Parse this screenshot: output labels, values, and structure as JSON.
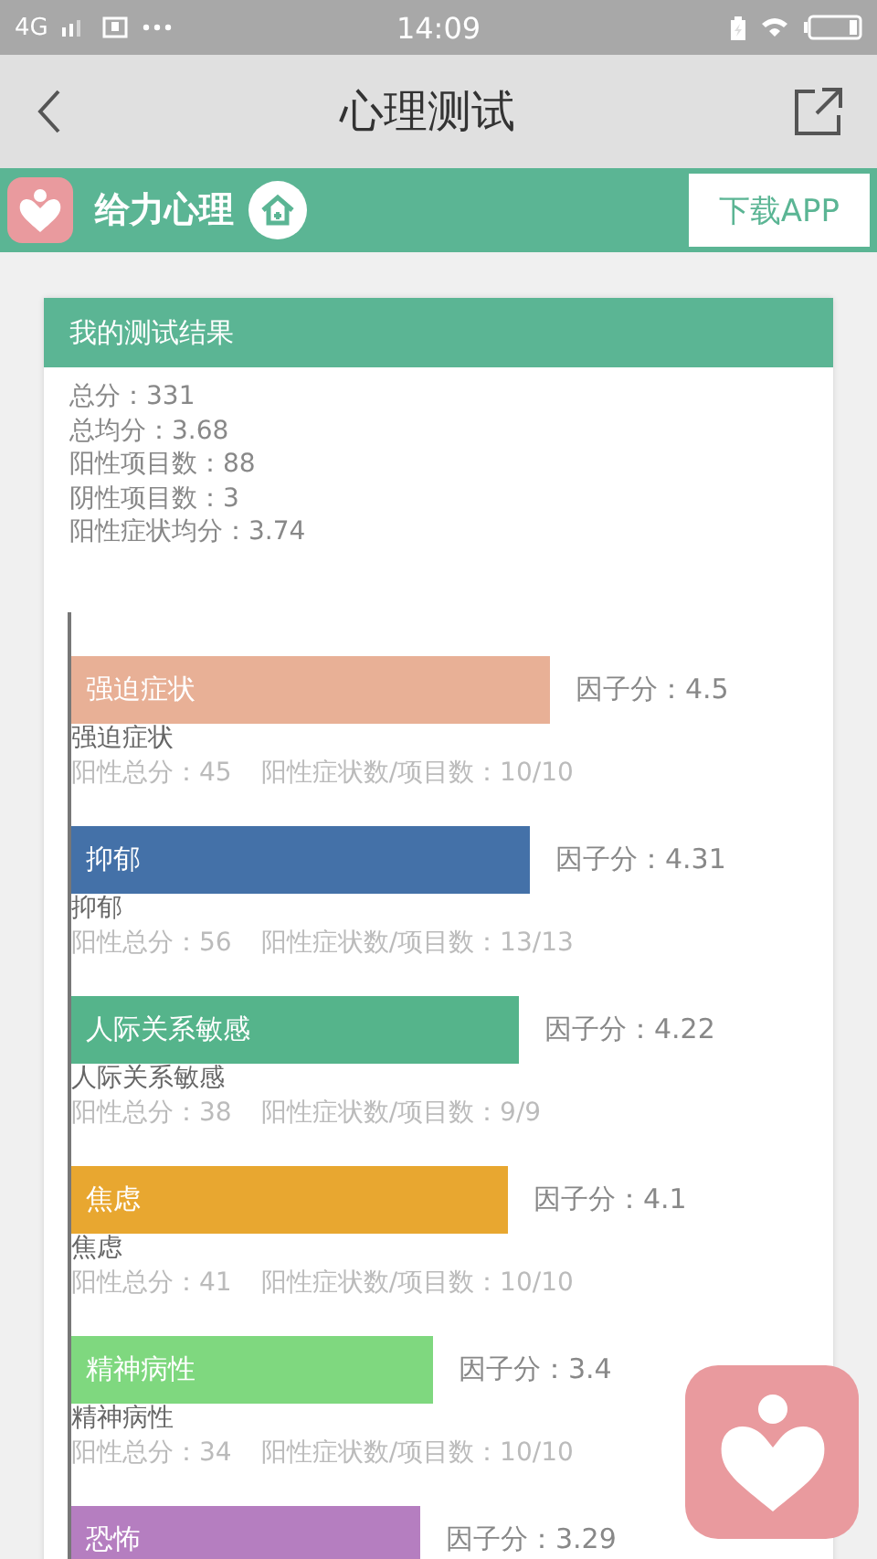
{
  "status_bar": {
    "network": "4G",
    "time": "14:09"
  },
  "nav": {
    "title": "心理测试"
  },
  "banner": {
    "brand": "给力心理",
    "download": "下载APP"
  },
  "card": {
    "title": "我的测试结果",
    "stats": [
      "总分：331",
      "总均分：3.68",
      "阳性项目数：88",
      "阴性项目数：3",
      "阳性症状均分：3.74"
    ],
    "factors": [
      {
        "name": "强迫症状",
        "score": "因子分：4.5",
        "color": "#e8b096",
        "caption": "强迫症状",
        "total": "阳性总分：45",
        "ratio": "阳性症状数/项目数：10/10"
      },
      {
        "name": "抑郁",
        "score": "因子分：4.31",
        "color": "#4471a8",
        "caption": "抑郁",
        "total": "阳性总分：56",
        "ratio": "阳性症状数/项目数：13/13"
      },
      {
        "name": "人际关系敏感",
        "score": "因子分：4.22",
        "color": "#55b48b",
        "caption": "人际关系敏感",
        "total": "阳性总分：38",
        "ratio": "阳性症状数/项目数：9/9"
      },
      {
        "name": "焦虑",
        "score": "因子分：4.1",
        "color": "#e8a730",
        "caption": "焦虑",
        "total": "阳性总分：41",
        "ratio": "阳性症状数/项目数：10/10"
      },
      {
        "name": "精神病性",
        "score": "因子分：3.4",
        "color": "#7fd87f",
        "caption": "精神病性",
        "total": "阳性总分：34",
        "ratio": "阳性症状数/项目数：10/10"
      },
      {
        "name": "恐怖",
        "score": "因子分：3.29",
        "color": "#b57ec0"
      }
    ]
  }
}
